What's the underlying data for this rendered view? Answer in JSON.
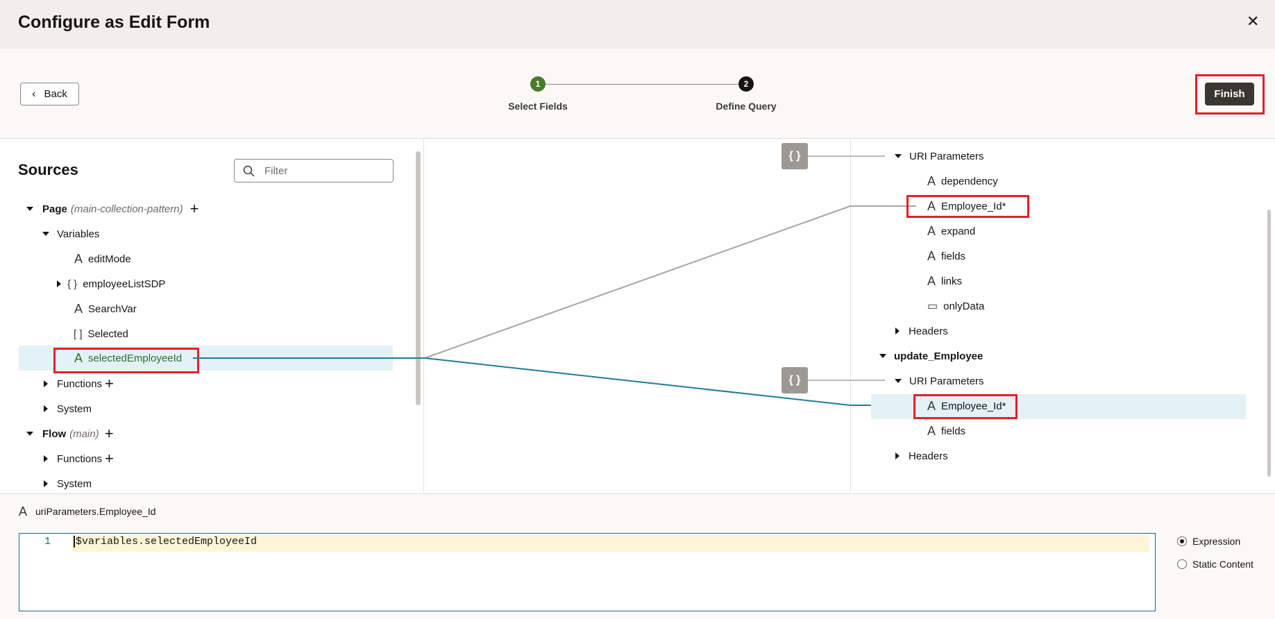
{
  "dialog": {
    "title": "Configure as Edit Form",
    "close_glyph": "✕"
  },
  "toolbar": {
    "back_label": "Back",
    "finish_label": "Finish"
  },
  "steps": [
    {
      "number": "1",
      "label": "Select Fields",
      "state": "current",
      "color": "#4a7c2a"
    },
    {
      "number": "2",
      "label": "Define Query",
      "state": "upcoming",
      "color": "#161513"
    }
  ],
  "sources": {
    "title": "Sources",
    "filter_placeholder": "Filter",
    "tree": {
      "page_label": "Page",
      "page_note": "(main-collection-pattern)",
      "variables_label": "Variables",
      "variables": [
        {
          "icon": "string-icon",
          "glyph": "A",
          "label": "editMode"
        },
        {
          "icon": "object-icon",
          "glyph": "{ }",
          "label": "employeeListSDP"
        },
        {
          "icon": "string-icon",
          "glyph": "A",
          "label": "SearchVar"
        },
        {
          "icon": "array-icon",
          "glyph": "[ ]",
          "label": "Selected"
        },
        {
          "icon": "string-icon",
          "glyph": "A",
          "label": "selectedEmployeeId"
        }
      ],
      "functions_label": "Functions",
      "system_label": "System",
      "flow_label": "Flow",
      "flow_note": "(main)",
      "flow_functions_label": "Functions",
      "flow_system_label": "System"
    }
  },
  "targets": {
    "uri_params_label": "URI Parameters",
    "params": [
      {
        "icon": "string-icon",
        "glyph": "A",
        "label": "dependency"
      },
      {
        "icon": "string-icon",
        "glyph": "A",
        "label": "Employee_Id*"
      },
      {
        "icon": "string-icon",
        "glyph": "A",
        "label": "expand"
      },
      {
        "icon": "string-icon",
        "glyph": "A",
        "label": "fields"
      },
      {
        "icon": "string-icon",
        "glyph": "A",
        "label": "links"
      },
      {
        "icon": "boolean-icon",
        "glyph": "▭",
        "label": "onlyData"
      }
    ],
    "headers_label": "Headers",
    "update_label": "update_Employee",
    "update_uri_params_label": "URI Parameters",
    "update_params": [
      {
        "icon": "string-icon",
        "glyph": "A",
        "label": "Employee_Id*"
      },
      {
        "icon": "string-icon",
        "glyph": "A",
        "label": "fields"
      }
    ],
    "update_headers_label": "Headers",
    "badge_glyph": "{ }"
  },
  "expression": {
    "path": "uriParameters.Employee_Id",
    "line_number": "1",
    "code": "$variables.selectedEmployeeId",
    "mode_options": [
      "Expression",
      "Static Content"
    ],
    "selected_mode": "Expression"
  },
  "colors": {
    "mapped_link": "#1f7a96",
    "unmapped_link": "#a8a4a0",
    "highlight": "#e0202c",
    "selected_text": "#2f6e2a",
    "selected_bg": "#e4f1f7"
  }
}
